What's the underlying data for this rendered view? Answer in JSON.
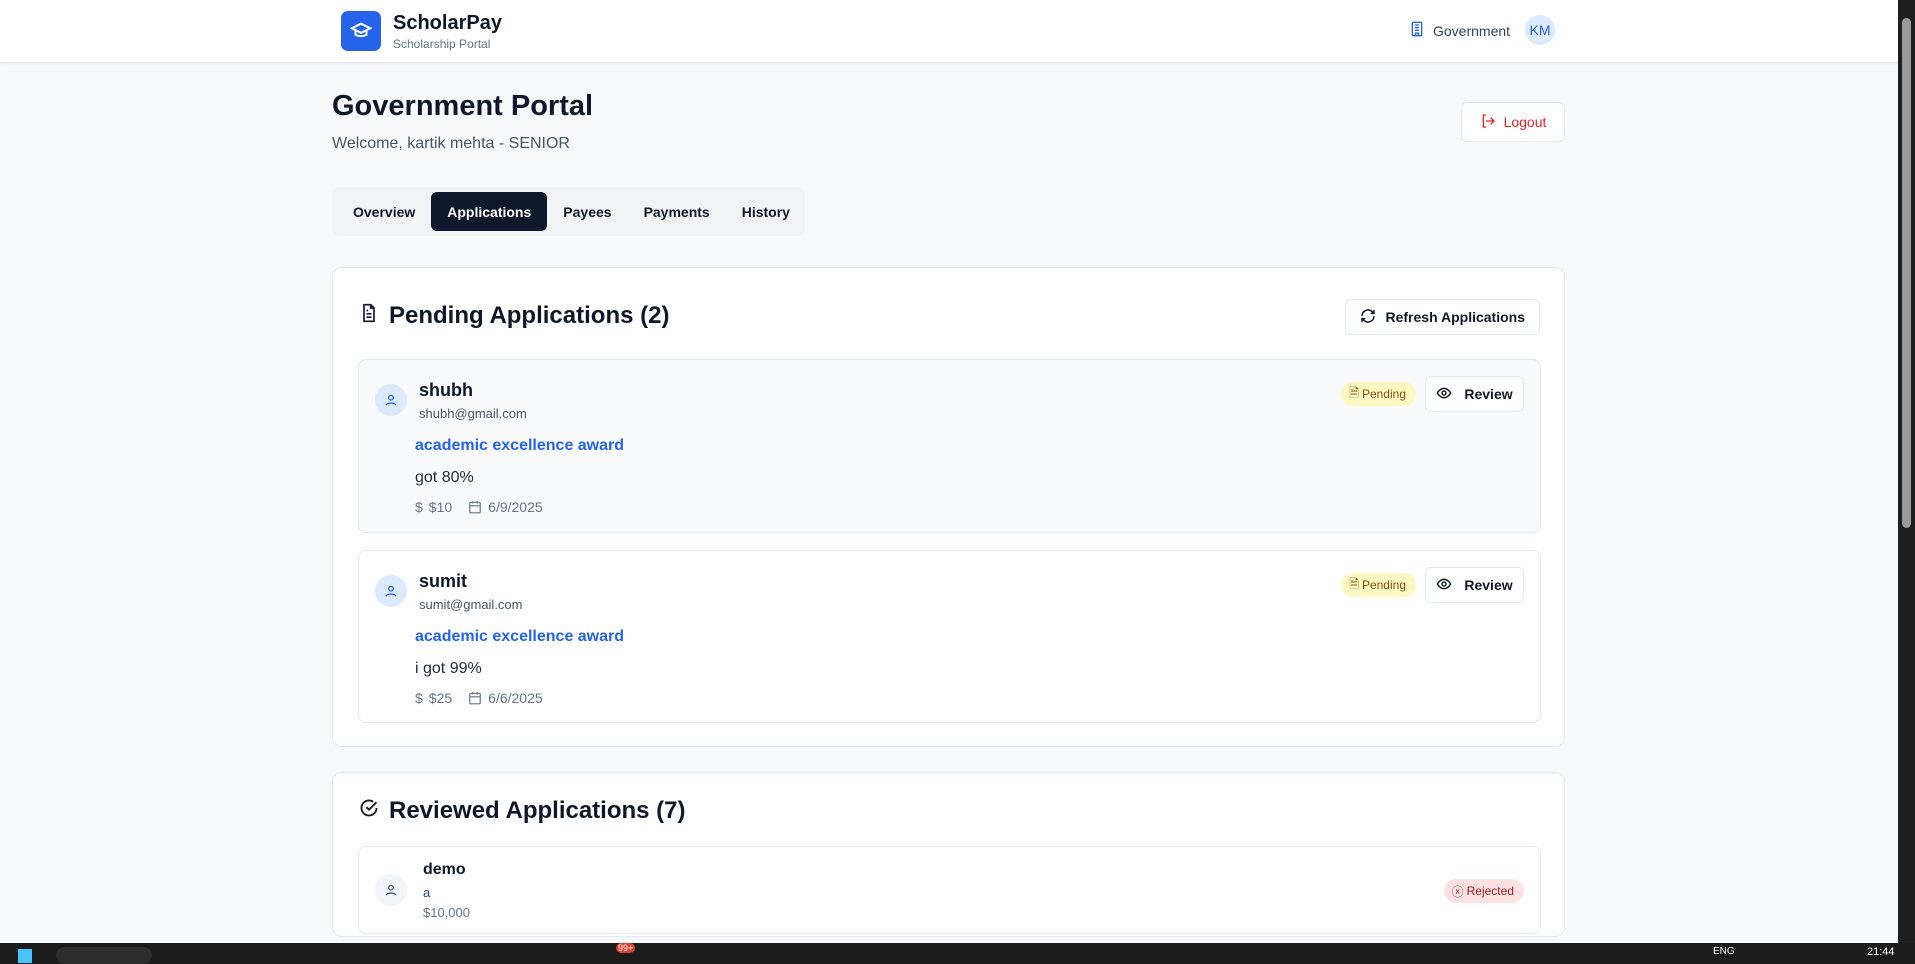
{
  "header": {
    "brand": "ScholarPay",
    "subtitle": "Scholarship Portal",
    "role": "Government",
    "avatar": "KM"
  },
  "page": {
    "title": "Government Portal",
    "welcome": "Welcome, kartik mehta - SENIOR",
    "logout": "Logout"
  },
  "tabs": [
    {
      "label": "Overview"
    },
    {
      "label": "Applications",
      "active": true
    },
    {
      "label": "Payees"
    },
    {
      "label": "Payments"
    },
    {
      "label": "History"
    }
  ],
  "pending": {
    "title": "Pending Applications (2)",
    "refresh": "Refresh Applications",
    "items": [
      {
        "name": "shubh",
        "email": "shubh@gmail.com",
        "scholarship": "academic excellence award",
        "reason": "got 80%",
        "amount": "$10",
        "date": "6/9/2025",
        "status": "Pending",
        "action": "Review"
      },
      {
        "name": "sumit",
        "email": "sumit@gmail.com",
        "scholarship": "academic excellence award",
        "reason": "i got 99%",
        "amount": "$25",
        "date": "6/6/2025",
        "status": "Pending",
        "action": "Review"
      }
    ]
  },
  "reviewed": {
    "title": "Reviewed Applications (7)",
    "items": [
      {
        "name": "demo",
        "scholarship": "a",
        "amount": "$10,000",
        "status": "Rejected"
      }
    ]
  },
  "taskbar": {
    "lang": "ENG",
    "time": "21:44",
    "badge": "99+"
  },
  "colors": {
    "accent": "#2563eb",
    "dark": "#0f172a",
    "pending": "#fef9c3",
    "rejected": "#fee2e2",
    "danger": "#dc2626"
  }
}
